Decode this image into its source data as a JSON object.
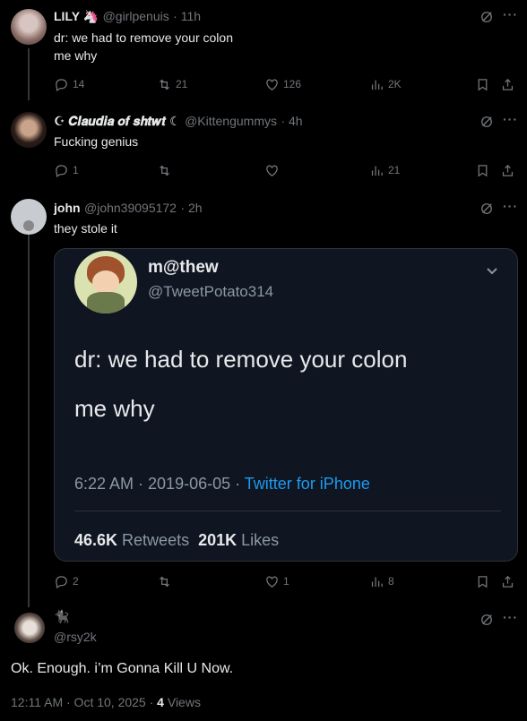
{
  "colors": {
    "bg": "#000000",
    "text": "#e7e9ea",
    "muted": "#71767b",
    "link": "#1d9bf0",
    "quote_bg": "#0f1521"
  },
  "replies": [
    {
      "name": "LILY 🦄",
      "handle": "@girlpenuis",
      "time": "11h",
      "lines": [
        "dr: we had to remove your colon",
        "me why"
      ],
      "stats": {
        "replies": "14",
        "reposts": "21",
        "likes": "126",
        "views": "2K"
      }
    },
    {
      "name": "☪︎ 𝑪𝒍𝒂𝒖𝒅𝒊𝒂 𝒐𝒇 𝒔𝒉𝒕𝒘𝒕 ☾",
      "handle": "@Kittengummys",
      "time": "4h",
      "lines": [
        "Fucking genius"
      ],
      "stats": {
        "replies": "1",
        "reposts": "",
        "likes": "",
        "views": "21"
      }
    },
    {
      "name": "john",
      "handle": "@john39095172",
      "time": "2h",
      "lines": [
        "they stole it"
      ],
      "stats": {
        "replies": "2",
        "reposts": "",
        "likes": "1",
        "views": "8"
      }
    }
  ],
  "quoted": {
    "name": "m@thew",
    "handle": "@TweetPotato314",
    "lines": [
      "dr: we had to remove your colon",
      "me why"
    ],
    "time": "6:22 AM · 2019-06-05 · ",
    "source": "Twitter for iPhone",
    "retweets_count": "46.6K",
    "retweets_label": " Retweets",
    "likes_count": "201K",
    "likes_label": " Likes"
  },
  "main_post": {
    "name_emoji": "🐈‍⬛",
    "handle": "@rsy2k",
    "text": "Ok. Enough. i’m Gonna Kill U Now.",
    "time": "12:11 AM · Oct 10, 2025 · ",
    "views_count": "4",
    "views_label": " Views"
  },
  "icons": [
    "reply-icon",
    "repost-icon",
    "like-icon",
    "views-icon",
    "bookmark-icon",
    "share-icon",
    "grok-icon",
    "more-icon",
    "chevron-down-icon"
  ]
}
